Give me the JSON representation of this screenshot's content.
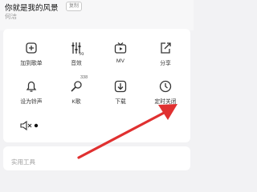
{
  "song": {
    "title": "你就是我的风景",
    "copy_label": "复制",
    "artist": "何洁"
  },
  "menu": {
    "items": [
      {
        "label": "加到歌单",
        "icon": "add-to-playlist-icon"
      },
      {
        "label": "音效",
        "icon": "equalizer-icon"
      },
      {
        "label": "MV",
        "icon": "mv-icon"
      },
      {
        "label": "分享",
        "icon": "share-icon"
      },
      {
        "label": "设为铃声",
        "icon": "ringtone-icon"
      },
      {
        "label": "K歌",
        "icon": "karaoke-icon",
        "badge": "338"
      },
      {
        "label": "下载",
        "icon": "download-icon"
      },
      {
        "label": "定时关闭",
        "icon": "timer-clock-icon"
      }
    ]
  },
  "volume": {
    "icon": "volume-mute-icon"
  },
  "tools": {
    "title": "实用工具"
  },
  "annotation": {
    "color": "#e03030",
    "icon": "red-arrow-pointer"
  }
}
